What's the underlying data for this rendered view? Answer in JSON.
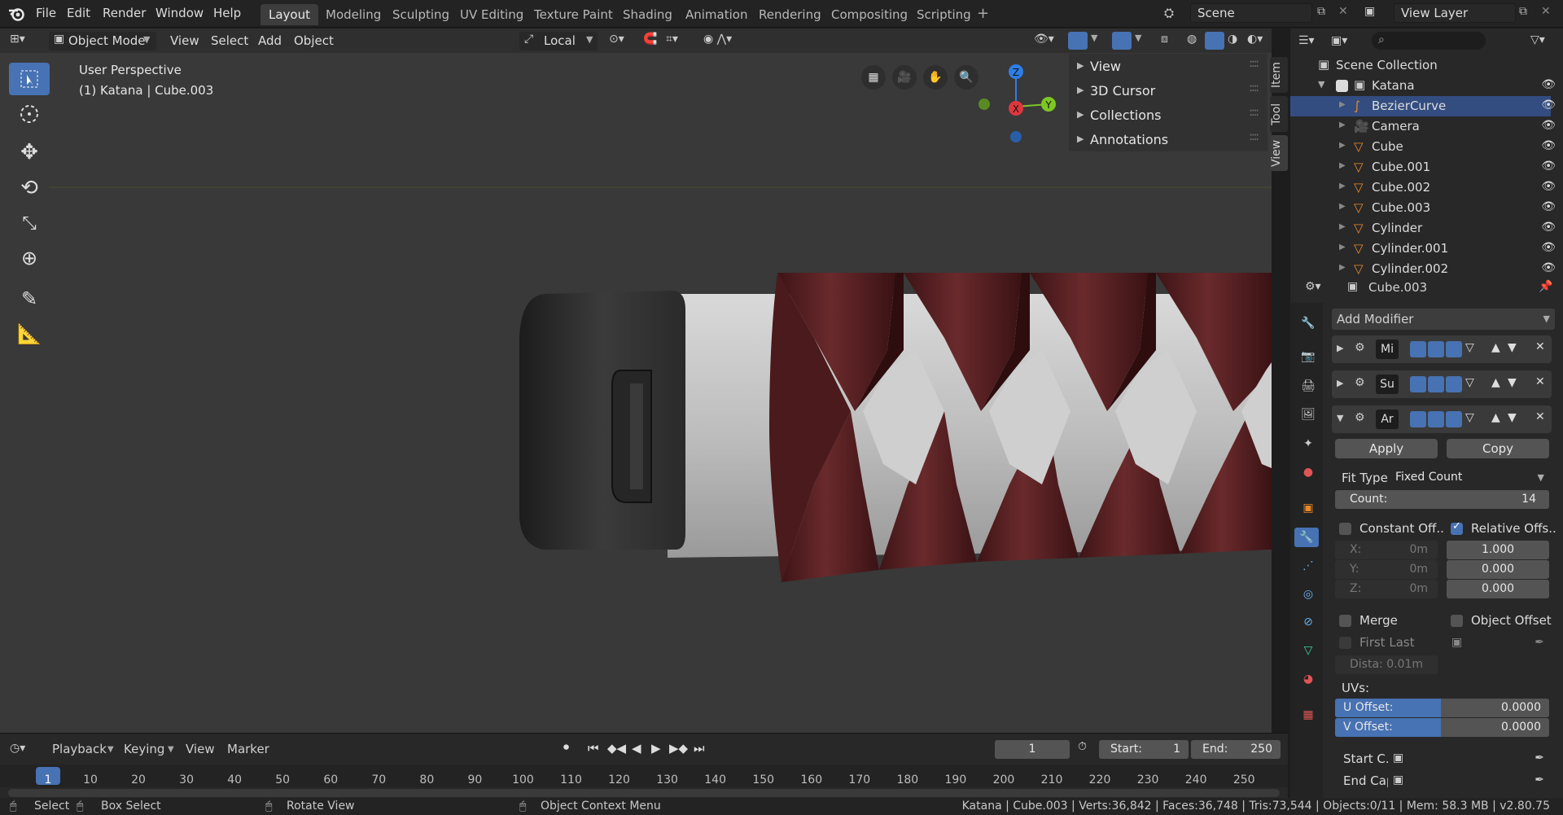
{
  "app": {
    "logo": "blender-logo"
  },
  "menu": [
    "File",
    "Edit",
    "Render",
    "Window",
    "Help"
  ],
  "workspaces": [
    "Layout",
    "Modeling",
    "Sculpting",
    "UV Editing",
    "Texture Paint",
    "Shading",
    "Animation",
    "Rendering",
    "Compositing",
    "Scripting"
  ],
  "active_workspace": "Layout",
  "scene": {
    "name": "Scene",
    "view_layer": "View Layer"
  },
  "viewport_header": {
    "mode": "Object Mode",
    "menus": [
      "View",
      "Select",
      "Add",
      "Object"
    ],
    "transform_orientation": "Local"
  },
  "viewport": {
    "perspective": "User Perspective",
    "object_info": "(1) Katana | Cube.003"
  },
  "npanel": {
    "sections": [
      "View",
      "3D Cursor",
      "Collections",
      "Annotations"
    ],
    "tabs": [
      "Item",
      "Tool",
      "View"
    ]
  },
  "gizmo": {
    "x": "X",
    "y": "Y",
    "z": "Z"
  },
  "outliner": {
    "root": "Scene Collection",
    "collection": "Katana",
    "items": [
      {
        "name": "BezierCurve",
        "selected": true
      },
      {
        "name": "Camera",
        "selected": false
      },
      {
        "name": "Cube",
        "selected": false
      },
      {
        "name": "Cube.001",
        "selected": false
      },
      {
        "name": "Cube.002",
        "selected": false
      },
      {
        "name": "Cube.003",
        "selected": false
      },
      {
        "name": "Cylinder",
        "selected": false
      },
      {
        "name": "Cylinder.001",
        "selected": false
      },
      {
        "name": "Cylinder.002",
        "selected": false
      }
    ]
  },
  "properties": {
    "object_name": "Cube.003",
    "add_modifier": "Add Modifier",
    "modifiers": [
      {
        "short": "Mi"
      },
      {
        "short": "Su"
      },
      {
        "short": "Ar"
      }
    ],
    "apply": "Apply",
    "copy": "Copy",
    "fit_type_label": "Fit Type:",
    "fit_type": "Fixed Count",
    "count_label": "Count:",
    "count": "14",
    "constant_offset": "Constant Off..",
    "relative_offset": "Relative Offs..",
    "const_x": "X:",
    "const_x_val": "0m",
    "const_y": "Y:",
    "const_y_val": "0m",
    "const_z": "Z:",
    "const_z_val": "0m",
    "rel_x": "1.000",
    "rel_y": "0.000",
    "rel_z": "0.000",
    "merge": "Merge",
    "object_offset": "Object Offset",
    "first_last": "First Last",
    "distance": "Dista:  0.01m",
    "uvs_label": "UVs:",
    "u_offset_label": "U Offset:",
    "u_offset": "0.0000",
    "v_offset_label": "V Offset:",
    "v_offset": "0.0000",
    "start_cap": "Start C..",
    "end_cap": "End Cap:"
  },
  "timeline": {
    "menus": [
      "Playback",
      "Keying",
      "View",
      "Marker"
    ],
    "current_frame": "1",
    "start_label": "Start:",
    "start": "1",
    "end_label": "End:",
    "end": "250",
    "ruler": [
      "1",
      "10",
      "20",
      "30",
      "40",
      "50",
      "60",
      "70",
      "80",
      "90",
      "100",
      "110",
      "120",
      "130",
      "140",
      "150",
      "160",
      "170",
      "180",
      "190",
      "200",
      "210",
      "220",
      "230",
      "240",
      "250"
    ]
  },
  "statusbar": {
    "select": "Select",
    "box_select": "Box Select",
    "rotate_view": "Rotate View",
    "context_menu": "Object Context Menu",
    "stats": "Katana | Cube.003 | Verts:36,842 | Faces:36,748 | Tris:73,544 | Objects:0/11 | Mem: 58.3 MB | v2.80.75"
  },
  "colors": {
    "accent": "#4772b3",
    "selection": "#334d80",
    "wrap": "#5a1f22",
    "x_axis": "#e0373c",
    "y_axis": "#7ec623",
    "z_axis": "#2f7ee6"
  }
}
